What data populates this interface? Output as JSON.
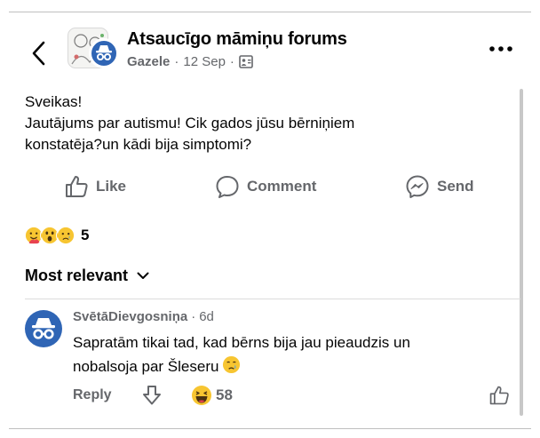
{
  "header": {
    "group_name": "Atsaucīgo māmiņu forums",
    "author": "Gazele",
    "separator": "·",
    "date": "12 Sep",
    "separator2": "·"
  },
  "post": {
    "line1": "Sveikas!",
    "line2": "Jautājums par autismu! Cik gados jūsu bērniņiem",
    "line3": "konstatēja?un kādi bija simptomi?"
  },
  "actions": {
    "like": "Like",
    "comment": "Comment",
    "send": "Send"
  },
  "reactions": {
    "icons": [
      "hug-emoji-icon",
      "wow-emoji-icon",
      "sad-emoji-icon"
    ],
    "count": "5"
  },
  "sort": {
    "label": "Most relevant"
  },
  "comment": {
    "author": "SvētāDievgosniņa",
    "separator": "·",
    "time": "6d",
    "line1": "Sapratām tikai tad, kad bērns bija jau pieaudzis un",
    "line2": "nobalsoja par Šleseru",
    "reply": "Reply",
    "laugh_count": "58"
  },
  "colors": {
    "avatar_blue": "#2f65b5",
    "muted_text": "#65676b",
    "reaction_yellow": "#f7c531"
  }
}
